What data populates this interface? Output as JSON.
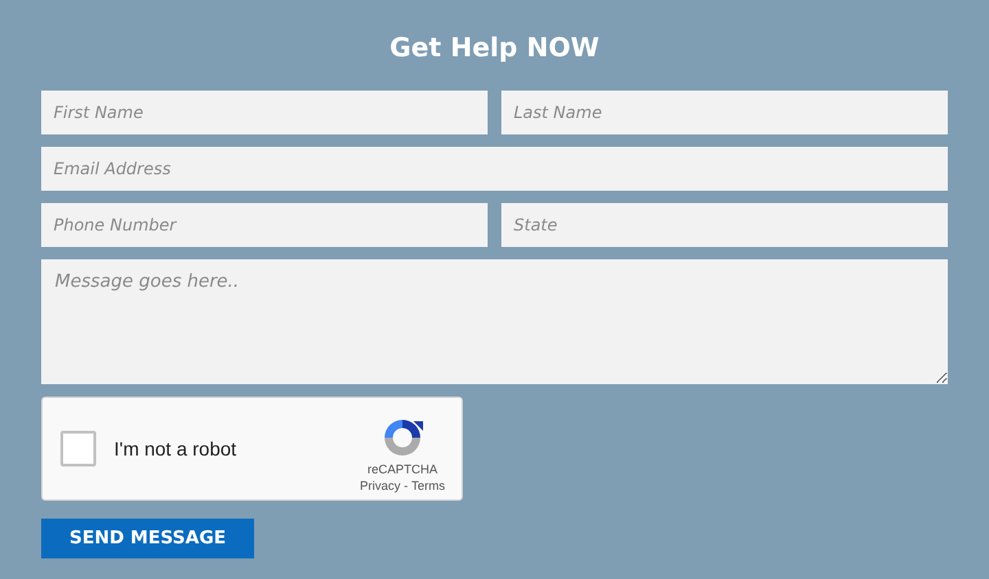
{
  "title": "Get Help NOW",
  "rows": [
    [
      {
        "placeholder": "First Name"
      },
      {
        "placeholder": "Last Name"
      }
    ],
    [
      {
        "placeholder": "Email Address"
      }
    ],
    [
      {
        "placeholder": "Phone Number"
      },
      {
        "placeholder": "State"
      }
    ]
  ],
  "message": {
    "placeholder": "Message goes here.."
  },
  "captcha": {
    "label": "I'm not a robot",
    "checked": false,
    "brand": "reCAPTCHA",
    "privacy": "Privacy",
    "separator": " - ",
    "terms": "Terms"
  },
  "submit": "SEND MESSAGE"
}
